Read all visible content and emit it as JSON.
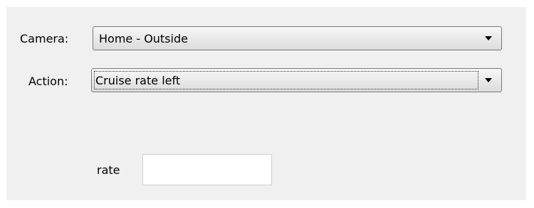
{
  "form": {
    "camera": {
      "label": "Camera:",
      "selected": "Home - Outside"
    },
    "action": {
      "label": "Action:",
      "selected": "Cruise rate left"
    },
    "rate": {
      "label": "rate",
      "value": ""
    }
  },
  "icons": {
    "dropdown": "chevron-down-icon"
  }
}
